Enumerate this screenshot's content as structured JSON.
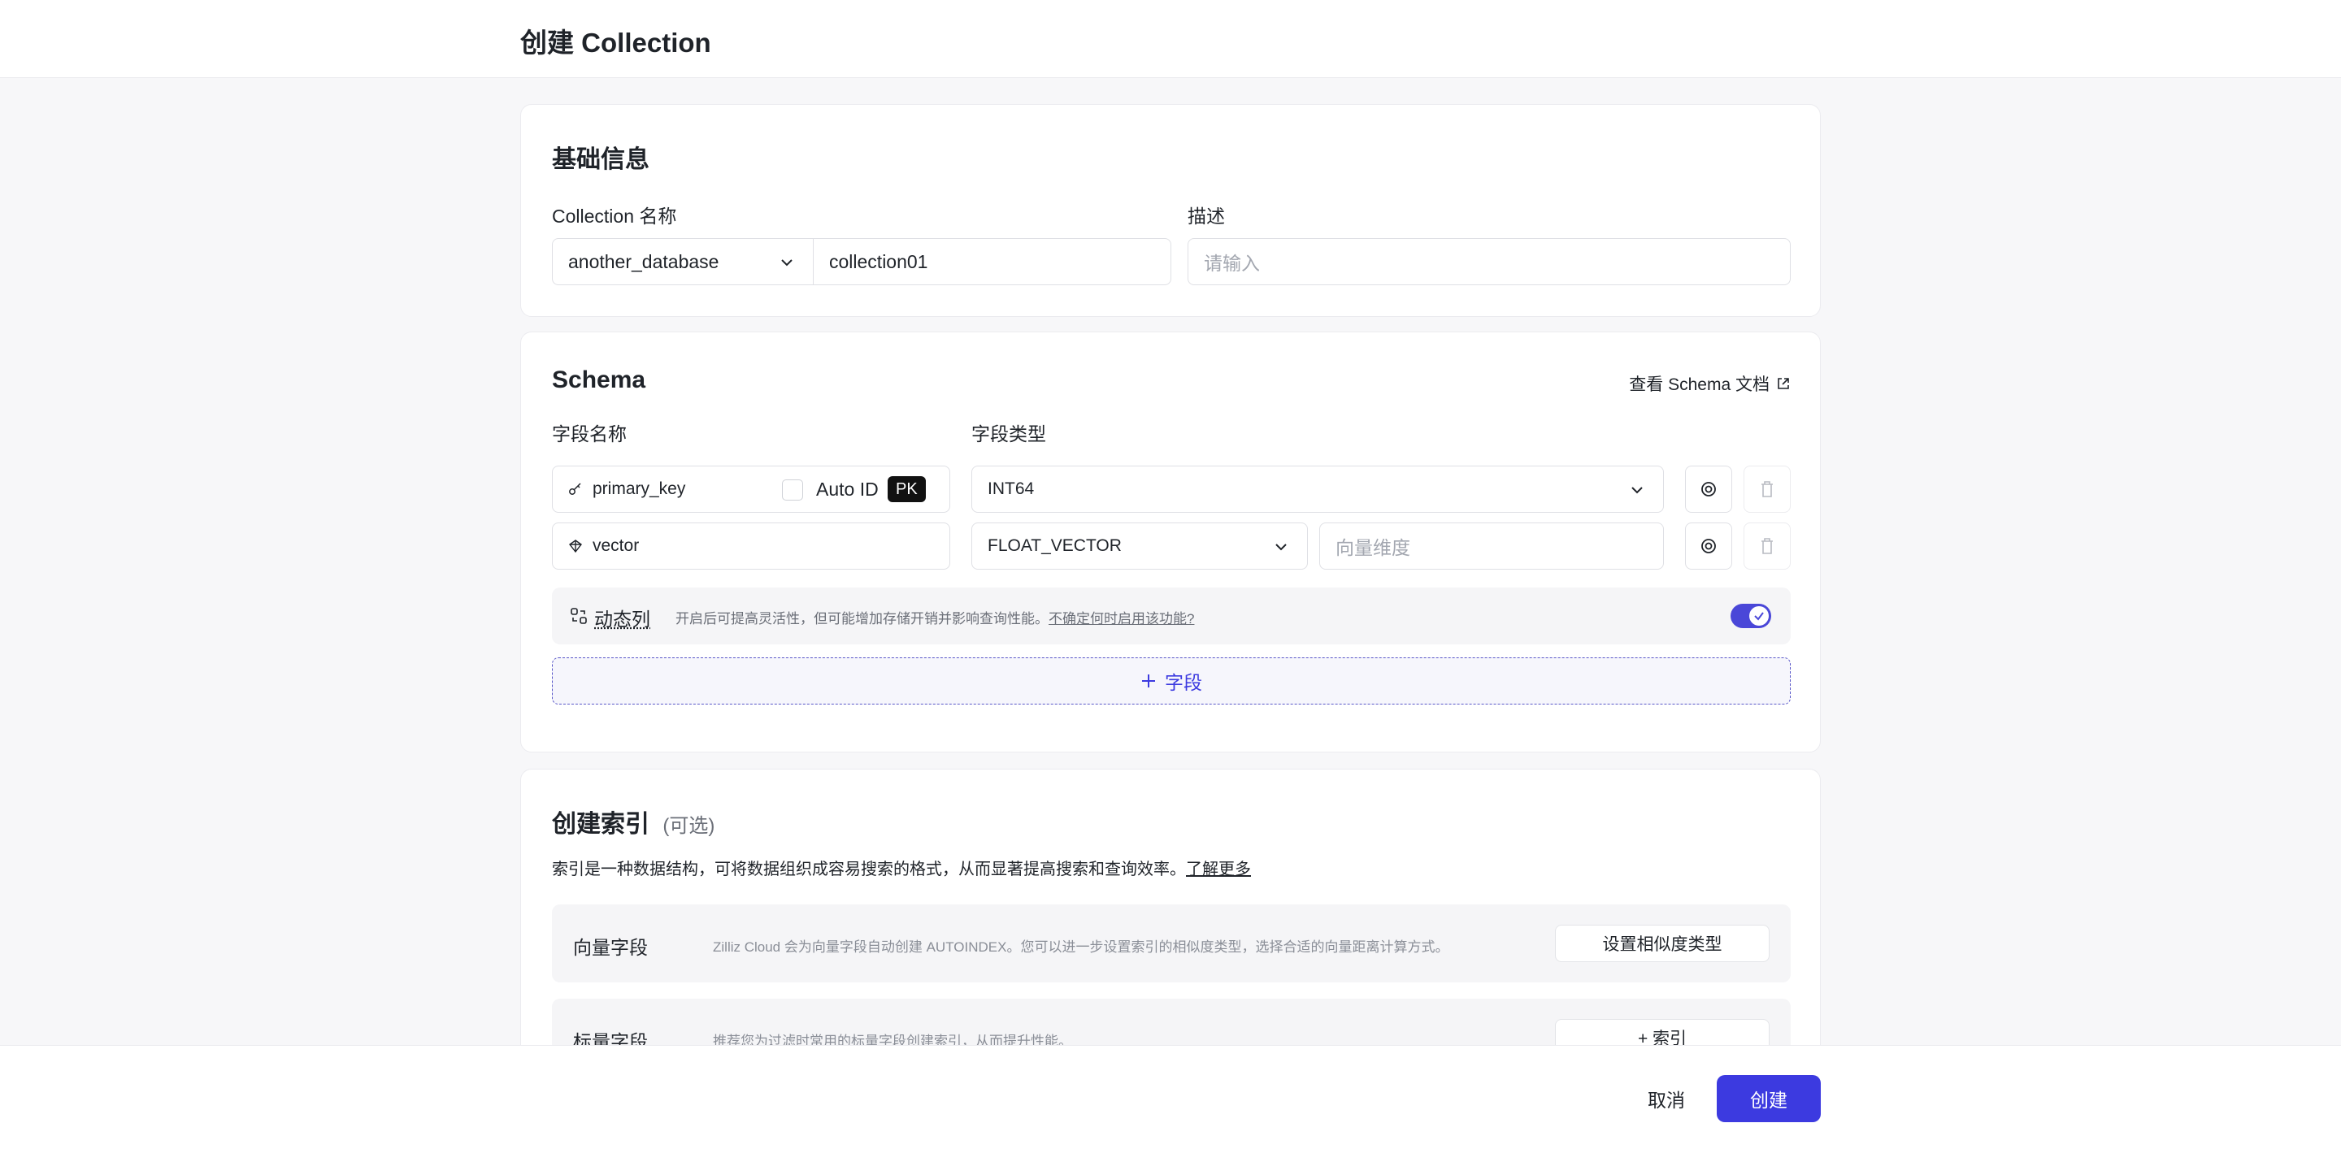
{
  "header": {
    "title": "创建 Collection"
  },
  "basic": {
    "title": "基础信息",
    "name_label": "Collection 名称",
    "database_value": "another_database",
    "collection_value": "collection01",
    "desc_label": "描述",
    "desc_placeholder": "请输入"
  },
  "schema": {
    "title": "Schema",
    "doc_link": "查看 Schema 文档",
    "col_name": "字段名称",
    "col_type": "字段类型",
    "fields": [
      {
        "name": "primary_key",
        "auto_id_label": "Auto ID",
        "pk_badge": "PK",
        "type": "INT64",
        "icon": "key-icon"
      },
      {
        "name": "vector",
        "type": "FLOAT_VECTOR",
        "dim_placeholder": "向量维度",
        "icon": "vector-icon"
      }
    ],
    "dynamic": {
      "label": "动态列",
      "desc": "开启后可提高灵活性，但可能增加存储开销并影响查询性能。",
      "link": "不确定何时启用该功能?",
      "enabled": true
    },
    "add_field_label": "字段"
  },
  "index": {
    "title": "创建索引",
    "optional": "(可选)",
    "desc": "索引是一种数据结构，可将数据组织成容易搜索的格式，从而显著提高搜索和查询效率。",
    "learn_more": "了解更多",
    "vector_row": {
      "label": "向量字段",
      "desc": "Zilliz Cloud 会为向量字段自动创建 AUTOINDEX。您可以进一步设置索引的相似度类型，选择合适的向量距离计算方式。",
      "button": "设置相似度类型"
    },
    "scalar_row": {
      "label": "标量字段",
      "desc": "推荐您为过滤时常用的标量字段创建索引，从而提升性能。",
      "button": "+ 索引"
    }
  },
  "footer": {
    "cancel": "取消",
    "create": "创建"
  },
  "colors": {
    "accent": "#3c3ae0",
    "toggle": "#4a47d8"
  }
}
